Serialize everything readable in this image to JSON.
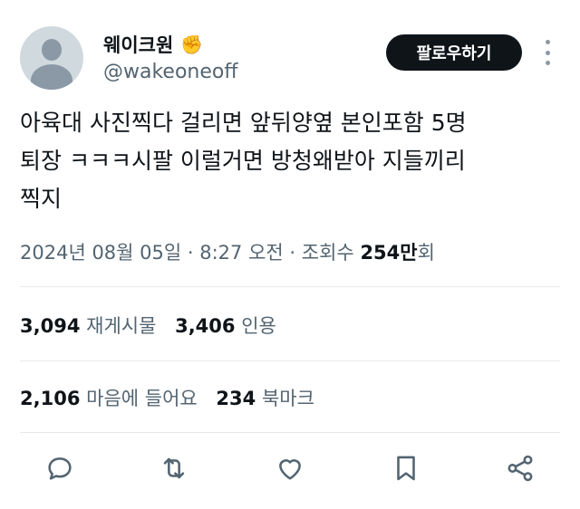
{
  "profile": {
    "display_name": "웨이크원",
    "handle": "@wakeoneoff",
    "name_emoji": "✊",
    "avatar_icon": "default-avatar-icon"
  },
  "follow_label": "팔로우하기",
  "tweet": {
    "text": "아육대 사진찍다 걸리면 앞뒤양옆 본인포함 5명\n퇴장 ㅋㅋㅋ시팔 이럴거면 방청왜받아 지들끼리\n찍지"
  },
  "meta": {
    "date": "2024년 08월 05일",
    "time": "8:27 오전",
    "views_label": "조회수",
    "views_count": "254만",
    "views_suffix": "회"
  },
  "stats": {
    "retweets_count": "3,094",
    "retweets_label": "재게시물",
    "quotes_count": "3,406",
    "quotes_label": "인용",
    "likes_count": "2,106",
    "likes_label": "마음에 들어요",
    "bookmarks_count": "234",
    "bookmarks_label": "북마크"
  },
  "actions": [
    "reply-icon",
    "retweet-icon",
    "like-icon",
    "bookmark-icon",
    "share-icon"
  ],
  "colors": {
    "text_primary": "#0f1419",
    "text_secondary": "#536471",
    "button_bg": "#0f1419",
    "button_text": "#ffffff",
    "divider": "#e6e9ec"
  }
}
